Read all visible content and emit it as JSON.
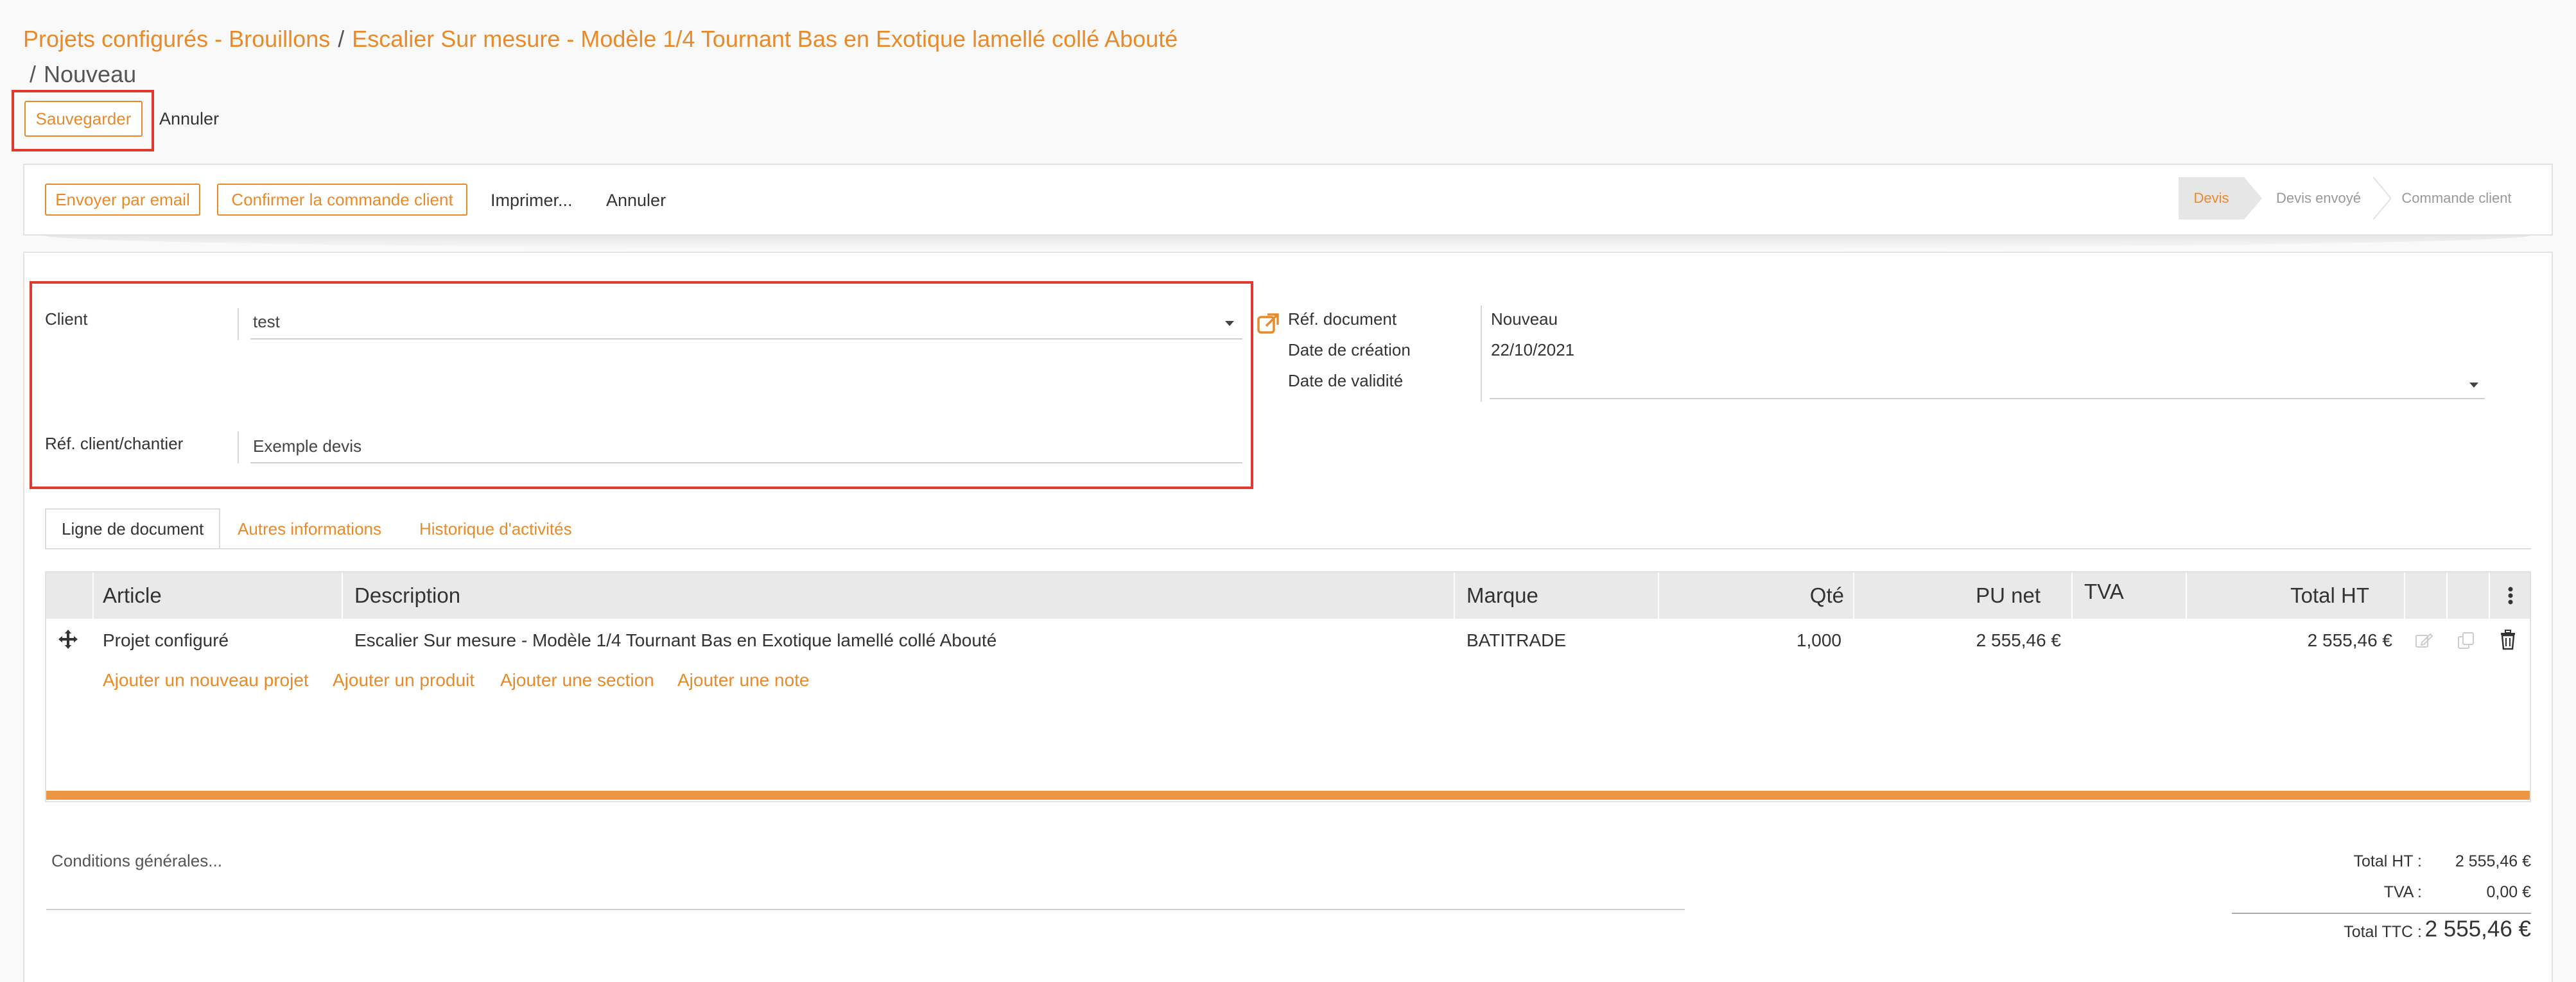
{
  "breadcrumb": {
    "crumb1": "Projets configurés - Brouillons",
    "crumb2": "Escalier Sur mesure - Modèle 1/4 Tournant Bas en Exotique lamellé collé Abouté",
    "current": "Nouveau",
    "separator": "/"
  },
  "form_actions": {
    "save": "Sauvegarder",
    "cancel": "Annuler"
  },
  "header_buttons": {
    "send_email": "Envoyer par email",
    "confirm_order": "Confirmer la commande client",
    "print": "Imprimer...",
    "cancel": "Annuler"
  },
  "status_stages": [
    {
      "label": "Devis",
      "active": true
    },
    {
      "label": "Devis envoyé",
      "active": false
    },
    {
      "label": "Commande client",
      "active": false
    }
  ],
  "fields": {
    "client_label": "Client",
    "client_value": "test",
    "ref_label": "Réf. client/chantier",
    "ref_value": "Exemple devis",
    "doc_ref_label": "Réf. document",
    "doc_ref_value": "Nouveau",
    "created_label": "Date de création",
    "created_value": "22/10/2021",
    "validity_label": "Date de validité",
    "validity_value": ""
  },
  "tabs": [
    "Ligne de document",
    "Autres informations",
    "Historique d'activités"
  ],
  "table": {
    "columns": [
      "Article",
      "Description",
      "Marque",
      "Qté",
      "PU net",
      "TVA",
      "Total HT"
    ],
    "rows": [
      {
        "article": "Projet configuré",
        "description": "Escalier Sur mesure - Modèle 1/4 Tournant Bas en Exotique lamellé collé Abouté",
        "marque": "BATITRADE",
        "qte": "1,000",
        "pu_net": "2 555,46 €",
        "tva": "",
        "total_ht": "2 555,46 €"
      }
    ],
    "add_links": [
      "Ajouter un nouveau projet",
      "Ajouter un produit",
      "Ajouter une section",
      "Ajouter une note"
    ]
  },
  "conditions_placeholder": "Conditions générales...",
  "totals": {
    "ht_label": "Total HT :",
    "ht_value": "2 555,46 €",
    "tva_label": "TVA :",
    "tva_value": "0,00 €",
    "ttc_label": "Total TTC :",
    "ttc_value": "2 555,46 €"
  },
  "colors": {
    "accent": "#e88a2a",
    "highlight": "#e03a2e",
    "progress_bar": "#ec9644"
  }
}
